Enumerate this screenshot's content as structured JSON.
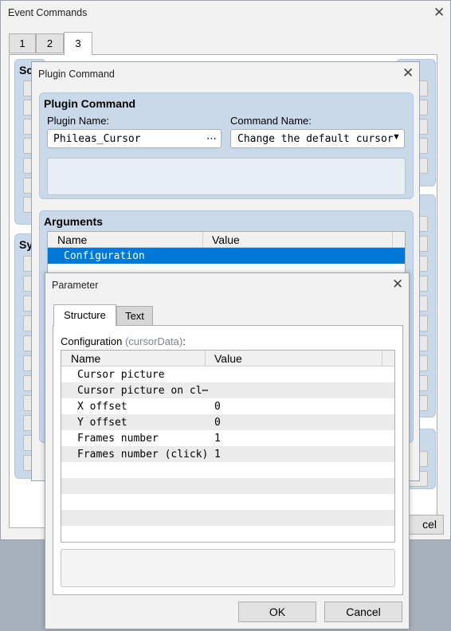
{
  "event_commands": {
    "title": "Event Commands",
    "tabs": [
      "1",
      "2",
      "3"
    ],
    "section_stub_1": "Sc",
    "section_stub_2": "Sy",
    "cancel_stub": "cel"
  },
  "plugin_command": {
    "title": "Plugin Command",
    "group_title": "Plugin Command",
    "plugin_name_label": "Plugin Name:",
    "plugin_name_value": "Phileas_Cursor",
    "plugin_browse": "⋯",
    "command_name_label": "Command Name:",
    "command_name_value": "Change the default cursor",
    "arguments_title": "Arguments",
    "arguments_columns": [
      "Name",
      "Value"
    ],
    "arguments_rows": [
      {
        "name": "Configuration",
        "value": ""
      }
    ]
  },
  "parameter": {
    "title": "Parameter",
    "tabs": [
      "Structure",
      "Text"
    ],
    "config_label": "Configuration",
    "config_key": "(cursorData)",
    "config_colon": ":",
    "columns": [
      "Name",
      "Value"
    ],
    "rows": [
      {
        "name": "Cursor picture",
        "value": ""
      },
      {
        "name": "Cursor picture on cl⋯",
        "value": ""
      },
      {
        "name": "X offset",
        "value": "0"
      },
      {
        "name": "Y offset",
        "value": "0"
      },
      {
        "name": "Frames number",
        "value": "1"
      },
      {
        "name": "Frames number (click)",
        "value": "1"
      }
    ],
    "ok_label": "OK",
    "cancel_label": "Cancel"
  },
  "colors": {
    "selection": "#0078d7",
    "group_bg": "#c9d9ea",
    "row_alt": "#ebebeb"
  }
}
